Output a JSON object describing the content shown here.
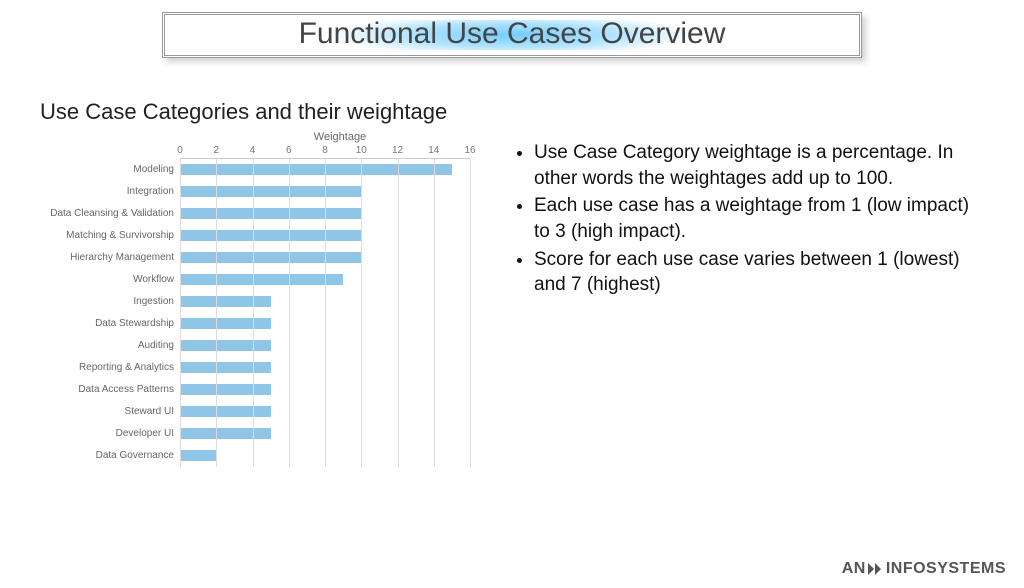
{
  "title": "Functional Use Cases Overview",
  "subtitle": "Use Case Categories and their weightage",
  "chart_data": {
    "type": "bar",
    "orientation": "horizontal",
    "title": "Weightage",
    "xlabel": "",
    "ylabel": "",
    "xlim": [
      0,
      16
    ],
    "ticks": [
      0,
      2,
      4,
      6,
      8,
      10,
      12,
      14,
      16
    ],
    "categories": [
      "Modeling",
      "Integration",
      "Data Cleansing & Validation",
      "Matching & Survivorship",
      "Hierarchy Management",
      "Workflow",
      "Ingestion",
      "Data Stewardship",
      "Auditing",
      "Reporting & Analytics",
      "Data Access Patterns",
      "Steward UI",
      "Developer UI",
      "Data Governance"
    ],
    "values": [
      15,
      10,
      10,
      10,
      10,
      9,
      5,
      5,
      5,
      5,
      5,
      5,
      5,
      2
    ],
    "bar_color": "#8fc6e8"
  },
  "bullets": [
    "Use Case Category weightage is a percentage. In other words the weightages add up to 100.",
    "Each use case has a weightage from 1 (low impact) to 3 (high impact).",
    "Score for each use case varies between 1 (lowest) and 7 (highest)"
  ],
  "logo": {
    "prefix": "AN",
    "suffix": "INFOSYSTEMS"
  }
}
